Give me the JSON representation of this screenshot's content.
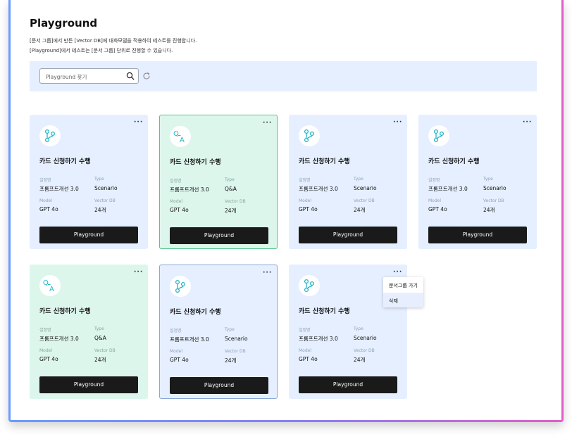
{
  "page": {
    "title": "Playground",
    "description_line1": "[문서 그룹]에서 만든 [Vector DB]에 대화모델을 적용하여 테스트를 진행합니다.",
    "description_line2": "[Playground]에서 테스트는 [문서 그룹] 단위로 진행할 수 있습니다."
  },
  "search": {
    "placeholder": "Playground 찾기",
    "icon": "search-icon",
    "refresh_icon": "refresh-icon"
  },
  "labels": {
    "config_name": "설정명",
    "type": "Type",
    "model": "Model",
    "vector_db": "Vector DB",
    "button": "Playground"
  },
  "cards": [
    {
      "title": "카드 신청하기 수행",
      "config_name": "프롬프트개선 3.0",
      "type": "Scenario",
      "model": "GPT 4o",
      "vector_db": "24개",
      "icon": "flow-icon",
      "state": "default"
    },
    {
      "title": "카드 신청하기 수행",
      "config_name": "프롬프트개선 3.0",
      "type": "Q&A",
      "model": "GPT 4o",
      "vector_db": "24개",
      "icon": "qa-icon",
      "state": "selected"
    },
    {
      "title": "카드 신청하기 수행",
      "config_name": "프롬프트개선 3.0",
      "type": "Scenario",
      "model": "GPT 4o",
      "vector_db": "24개",
      "icon": "flow-icon",
      "state": "default"
    },
    {
      "title": "카드 신청하기 수행",
      "config_name": "프롬프트개선 3.0",
      "type": "Scenario",
      "model": "GPT 4o",
      "vector_db": "24개",
      "icon": "flow-icon",
      "state": "default"
    },
    {
      "title": "카드 신청하기 수행",
      "config_name": "프롬프트개선 3.0",
      "type": "Q&A",
      "model": "GPT 4o",
      "vector_db": "24개",
      "icon": "qa-icon",
      "state": "default"
    },
    {
      "title": "카드 신청하기 수행",
      "config_name": "프롬프트개선 3.0",
      "type": "Scenario",
      "model": "GPT 4o",
      "vector_db": "24개",
      "icon": "flow-icon",
      "state": "selected"
    },
    {
      "title": "카드 신청하기 수행",
      "config_name": "프롬프트개선 3.0",
      "type": "Scenario",
      "model": "GPT 4o",
      "vector_db": "24개",
      "icon": "flow-icon",
      "state": "menu-open"
    }
  ],
  "context_menu": {
    "items": [
      "문서그룹 가기",
      "삭제"
    ],
    "highlighted": "삭제"
  },
  "colors": {
    "scenario_card_bg": "#e5efff",
    "qa_card_bg": "#dcf6ec",
    "accent_teal": "#1fb7c5",
    "button_bg": "#1a1a1a",
    "frame_gradient_start": "#6a9bff",
    "frame_gradient_end": "#e05fc8"
  }
}
